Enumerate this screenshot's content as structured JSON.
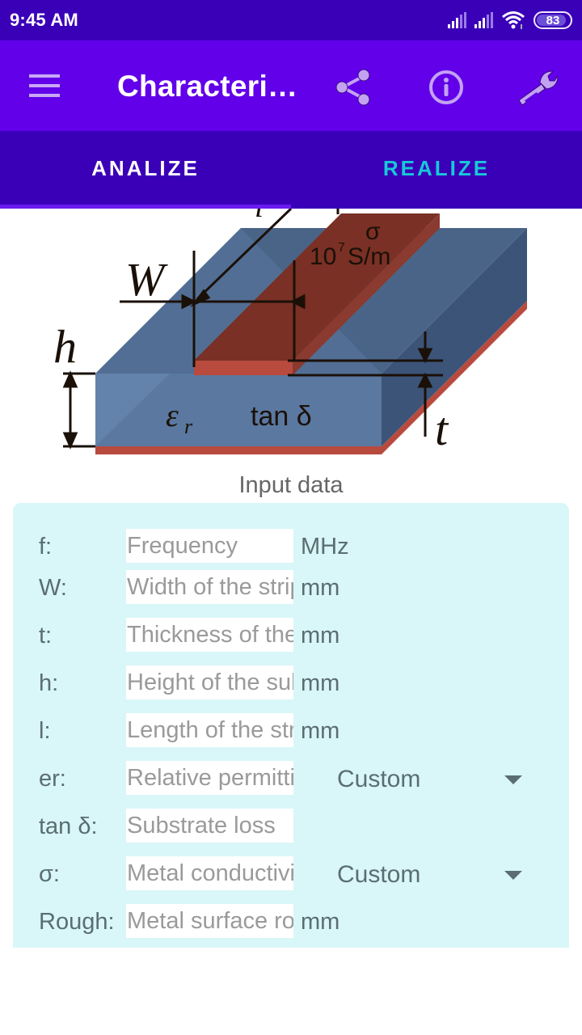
{
  "status_bar": {
    "time": "9:45 AM",
    "battery": "83",
    "icons": [
      "signal-icon",
      "signal-icon",
      "wifi-icon",
      "battery-icon"
    ]
  },
  "app_bar": {
    "title": "Characteri…",
    "menu_icon": "menu-icon",
    "actions": [
      {
        "name": "share",
        "icon": "share-icon"
      },
      {
        "name": "info",
        "icon": "info-icon"
      },
      {
        "name": "settings",
        "icon": "wrench-icon"
      }
    ]
  },
  "tabs": [
    {
      "label": "ANALIZE",
      "active": true
    },
    {
      "label": "REALIZE",
      "active": false
    }
  ],
  "diagram": {
    "labels": {
      "W": "W",
      "h": "h",
      "t": "t",
      "l": "l",
      "sigma": "σ",
      "sigma_value": "10",
      "sigma_exp": "7",
      "sigma_unit": "S/m",
      "er": "ε",
      "er_sub": "r",
      "tan": "tan δ"
    }
  },
  "section_title": "Input data",
  "form": {
    "rows": [
      {
        "label": "f:",
        "placeholder": "Frequency",
        "value": "",
        "unit": "MHz"
      },
      {
        "label": "W:",
        "placeholder": "Width of the strip",
        "value": "",
        "unit": "mm"
      },
      {
        "label": "t:",
        "placeholder": "Thickness of the strip",
        "value": "",
        "unit": "mm"
      },
      {
        "label": "h:",
        "placeholder": "Height of the substrate",
        "value": "",
        "unit": "mm"
      },
      {
        "label": "l:",
        "placeholder": "Length of the strip",
        "value": "",
        "unit": "mm"
      },
      {
        "label": "er:",
        "placeholder": "Relative permittivity",
        "value": "",
        "dropdown": "Custom"
      },
      {
        "label": "tan δ:",
        "placeholder": "Substrate loss",
        "value": ""
      },
      {
        "label": "σ:",
        "placeholder": "Metal conductivity",
        "value": "",
        "dropdown": "Custom"
      },
      {
        "label": "Rough:",
        "placeholder": "Metal surface roughness",
        "value": "",
        "unit": "mm"
      }
    ]
  },
  "colors": {
    "status_bar": "#3a00b8",
    "app_bar": "#6200ea",
    "tab_bar": "#3a00b8",
    "tab_active_text": "#ffffff",
    "tab_inactive_text": "#18c8d8",
    "form_background": "#d9f6f8",
    "substrate": "#56729a",
    "strip": "#7a3024"
  }
}
